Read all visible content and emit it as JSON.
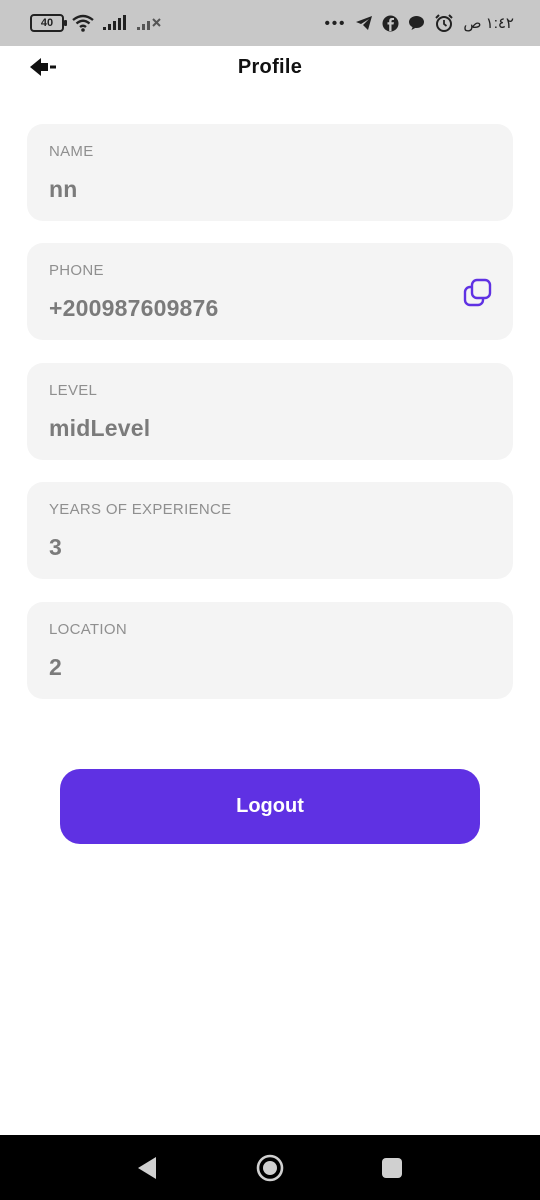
{
  "status_bar": {
    "battery": "40",
    "more_indicator": "•••",
    "time": "١:٤٢ ص"
  },
  "header": {
    "title": "Profile"
  },
  "fields": [
    {
      "label": "NAME",
      "value": "nn"
    },
    {
      "label": "PHONE",
      "value": "+200987609876"
    },
    {
      "label": "LEVEL",
      "value": "midLevel"
    },
    {
      "label": "YEARS OF EXPERIENCE",
      "value": "3"
    },
    {
      "label": "LOCATION",
      "value": "2"
    }
  ],
  "actions": {
    "logout_label": "Logout"
  },
  "colors": {
    "accent": "#5f31e3",
    "field_background": "#f4f4f4",
    "status_bar": "#c8c8c8"
  },
  "icons": {
    "back": "back-arrow-icon",
    "copy": "copy-icon",
    "nav_back": "triangle-back-icon",
    "nav_home": "circle-home-icon",
    "nav_recents": "square-recents-icon"
  }
}
